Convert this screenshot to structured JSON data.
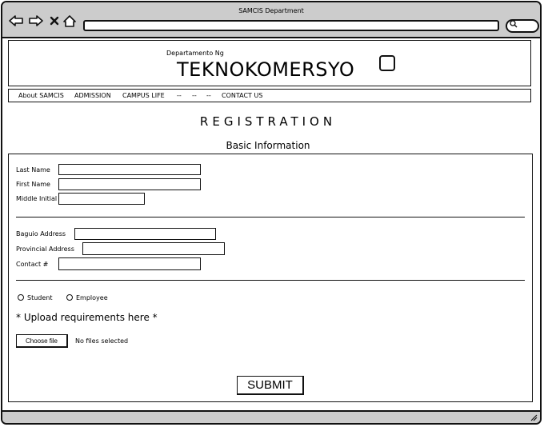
{
  "window": {
    "title": "SAMCIS Department"
  },
  "browser": {
    "icons": [
      "back-arrow-icon",
      "forward-arrow-icon",
      "close-icon",
      "home-icon",
      "search-icon"
    ],
    "url": ""
  },
  "header": {
    "subtitle": "Departamento Ng",
    "brand": "TEKNOKOMERSYO"
  },
  "menu": {
    "items": [
      "About SAMCIS",
      "ADMISSION",
      "CAMPUS LIFE",
      "--",
      "--",
      "--",
      "CONTACT US"
    ]
  },
  "page": {
    "title": "REGISTRATION",
    "section": "Basic Information"
  },
  "form": {
    "last_name_label": "Last Name",
    "first_name_label": "First Name",
    "middle_initial_label": "Middle Initial",
    "baguio_address_label": "Baguio Address",
    "provincial_address_label": "Provincial Address",
    "contact_label": "Contact #",
    "values": {
      "last_name": "",
      "first_name": "",
      "middle_initial": "",
      "baguio_address": "",
      "provincial_address": "",
      "contact": ""
    },
    "radio": {
      "student": "Student",
      "employee": "Employee"
    },
    "upload_label": "* Upload requirements here *",
    "choose_file": "Choose file",
    "no_file": "No files selected",
    "submit": "SUBMIT"
  },
  "colors": {
    "chrome": "#cccccc",
    "border": "#111111",
    "background": "#ffffff"
  }
}
